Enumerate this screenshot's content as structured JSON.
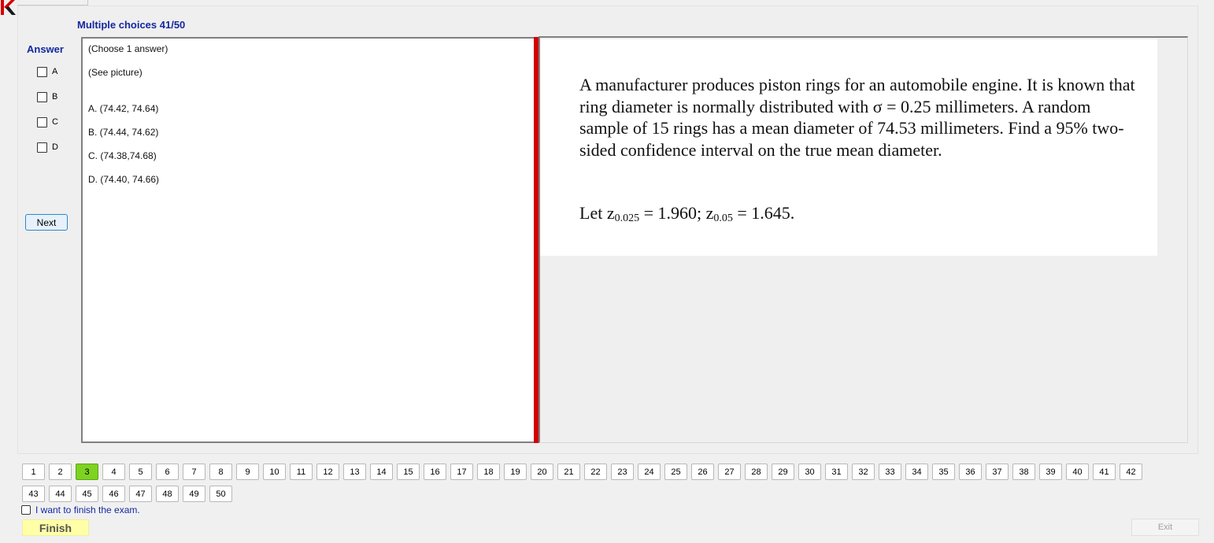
{
  "header": {
    "title": "Multiple choices 41/50"
  },
  "answer_panel": {
    "label": "Answer",
    "choices": [
      "A",
      "B",
      "C",
      "D"
    ],
    "next_label": "Next"
  },
  "answer_box": {
    "instruction": "(Choose 1 answer)",
    "see_picture": "(See picture)",
    "options": [
      "A.  (74.42, 74.64)",
      "B.  (74.44, 74.62)",
      "C.  (74.38,74.68)",
      "D.  (74.40, 74.66)"
    ]
  },
  "question": {
    "text": "A manufacturer produces piston rings for an automobile engine. It is known that ring diameter is normally distributed with σ = 0.25 millimeters. A random sample of 15 rings has a mean diameter of 74.53 millimeters.  Find a 95% two-sided confidence interval on the true mean diameter.",
    "let_prefix": "Let z",
    "z1_sub": "0.025",
    "z1_rest": " = 1.960; z",
    "z2_sub": "0.05",
    "z2_rest": " = 1.645."
  },
  "question_nav": {
    "numbers": [
      "1",
      "2",
      "3",
      "4",
      "5",
      "6",
      "7",
      "8",
      "9",
      "10",
      "11",
      "12",
      "13",
      "14",
      "15",
      "16",
      "17",
      "18",
      "19",
      "20",
      "21",
      "22",
      "23",
      "24",
      "25",
      "26",
      "27",
      "28",
      "29",
      "30",
      "31",
      "32",
      "33",
      "34",
      "35",
      "36",
      "37",
      "38",
      "39",
      "40",
      "41",
      "42",
      "43",
      "44",
      "45",
      "46",
      "47",
      "48",
      "49",
      "50"
    ],
    "highlighted": "3",
    "highlight_color": "#7ed321"
  },
  "footer": {
    "finish_check_label": "I want to finish the exam.",
    "finish_label": "Finish",
    "exit_label": "Exit"
  },
  "colors": {
    "accent_text": "#1428a0",
    "splitter": "#d40000",
    "finish_bg": "#ffffa8",
    "logo": "#d40000"
  }
}
